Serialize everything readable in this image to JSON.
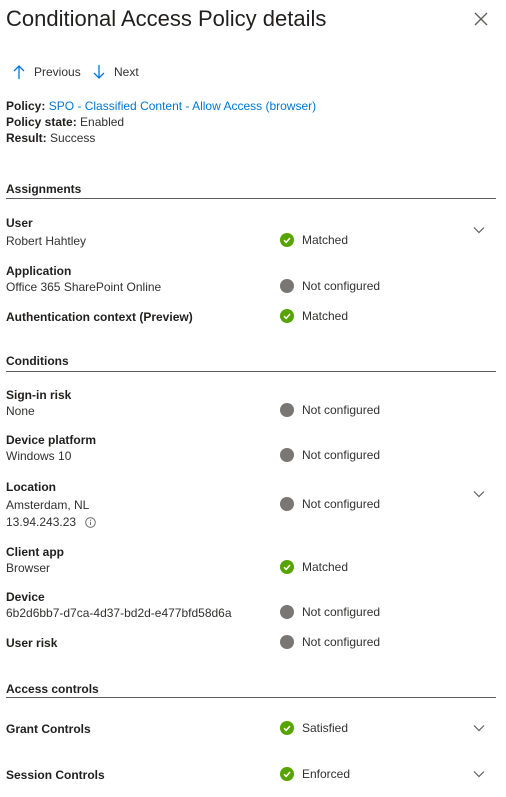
{
  "header": {
    "title": "Conditional Access Policy details",
    "previous_label": "Previous",
    "next_label": "Next"
  },
  "summary": {
    "policy_label": "Policy:",
    "policy_value": "SPO - Classified Content - Allow Access (browser)",
    "state_label": "Policy state:",
    "state_value": "Enabled",
    "result_label": "Result:",
    "result_value": "Success"
  },
  "assignments": {
    "heading": "Assignments",
    "user": {
      "label": "User",
      "value": "Robert Hahtley",
      "status": "Matched"
    },
    "application": {
      "label": "Application",
      "value": "Office 365 SharePoint Online",
      "status": "Not configured"
    },
    "auth_context": {
      "label": "Authentication context (Preview)",
      "status": "Matched"
    }
  },
  "conditions": {
    "heading": "Conditions",
    "signin_risk": {
      "label": "Sign-in risk",
      "value": "None",
      "status": "Not configured"
    },
    "device_platform": {
      "label": "Device platform",
      "value": "Windows 10",
      "status": "Not configured"
    },
    "location": {
      "label": "Location",
      "value": "Amsterdam, NL",
      "ip": "13.94.243.23",
      "status": "Not configured"
    },
    "client_app": {
      "label": "Client app",
      "value": "Browser",
      "status": "Matched"
    },
    "device": {
      "label": "Device",
      "value": "6b2d6bb7-d7ca-4d37-bd2d-e477bfd58d6a",
      "status": "Not configured"
    },
    "user_risk": {
      "label": "User risk",
      "status": "Not configured"
    }
  },
  "access_controls": {
    "heading": "Access controls",
    "grant": {
      "label": "Grant Controls",
      "status": "Satisfied"
    },
    "session": {
      "label": "Session Controls",
      "status": "Enforced"
    }
  },
  "colors": {
    "success": "#57a300",
    "neutral": "#797775",
    "link": "#0078d4"
  }
}
